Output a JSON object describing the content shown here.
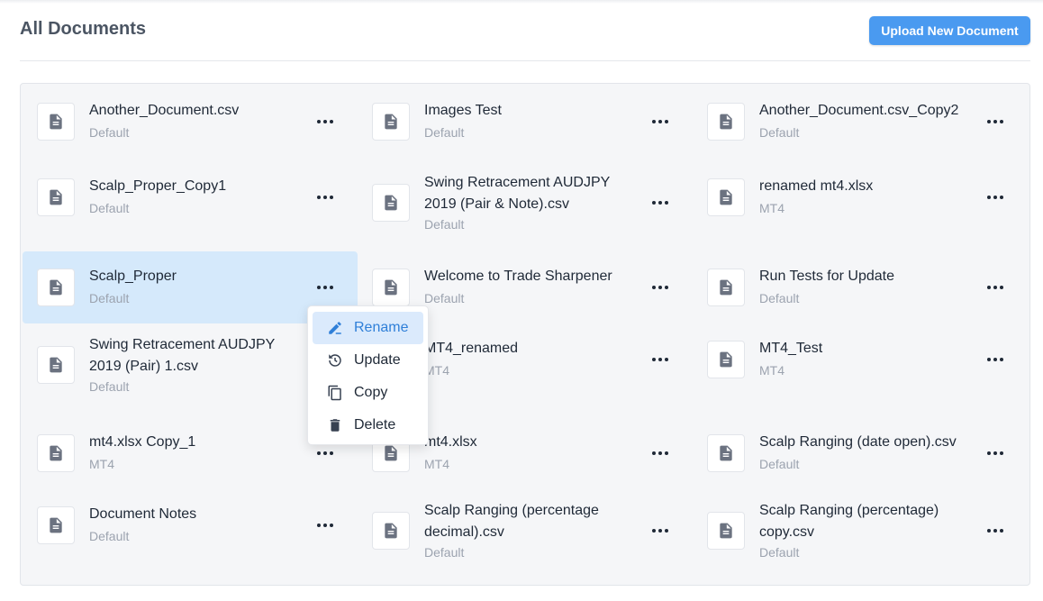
{
  "header": {
    "title": "All Documents",
    "upload_label": "Upload New Document"
  },
  "colors": {
    "accent": "#4a9af0",
    "selected_bg": "#d5e9fb",
    "menu_active_text": "#2f7fd8"
  },
  "columns": [
    {
      "cards": [
        {
          "name": "Another_Document.csv",
          "category": "Default"
        },
        {
          "name": "Scalp_Proper_Copy1",
          "category": "Default"
        },
        {
          "name": "Scalp_Proper",
          "category": "Default",
          "selected": true
        },
        {
          "name": "Swing Retracement AUDJPY 2019 (Pair) 1.csv",
          "category": "Default"
        },
        {
          "name": "mt4.xlsx Copy_1",
          "category": "MT4"
        },
        {
          "name": "Document Notes",
          "category": "Default"
        }
      ]
    },
    {
      "cards": [
        {
          "name": "Images Test",
          "category": "Default"
        },
        {
          "name": "Swing Retracement AUDJPY 2019 (Pair & Note).csv",
          "category": "Default"
        },
        {
          "name": "Welcome to Trade Sharpener",
          "category": "Default"
        },
        {
          "name": "MT4_renamed",
          "category": "MT4"
        },
        {
          "name": "mt4.xlsx",
          "category": "MT4"
        },
        {
          "name": "Scalp Ranging (percentage decimal).csv",
          "category": "Default"
        }
      ]
    },
    {
      "cards": [
        {
          "name": "Another_Document.csv_Copy2",
          "category": "Default"
        },
        {
          "name": "renamed mt4.xlsx",
          "category": "MT4"
        },
        {
          "name": "Run Tests for Update",
          "category": "Default"
        },
        {
          "name": "MT4_Test",
          "category": "MT4"
        },
        {
          "name": "Scalp Ranging (date open).csv",
          "category": "Default"
        },
        {
          "name": "Scalp Ranging (percentage) copy.csv",
          "category": "Default"
        }
      ]
    }
  ],
  "context_menu": {
    "items": [
      {
        "label": "Rename",
        "icon": "pencil-icon",
        "active": true
      },
      {
        "label": "Update",
        "icon": "history-icon"
      },
      {
        "label": "Copy",
        "icon": "copy-icon"
      },
      {
        "label": "Delete",
        "icon": "trash-icon"
      }
    ]
  }
}
